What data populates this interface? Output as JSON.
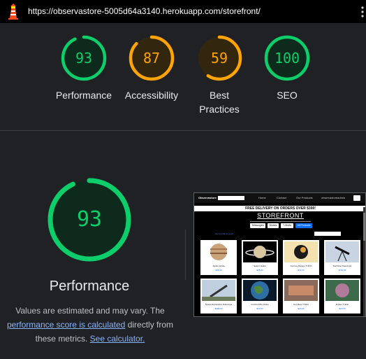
{
  "topbar": {
    "url": "https://observastore-5005d64a3140.herokuapp.com/storefront/",
    "logo_icon": "lighthouse-icon",
    "menu_icon": "kebab-menu-icon"
  },
  "scores": [
    {
      "name": "Performance",
      "value": "93",
      "score": 93,
      "color": "#0cce6b",
      "bg": "#0e2a1c"
    },
    {
      "name": "Accessibility",
      "value": "87",
      "score": 87,
      "color": "#ffa400",
      "bg": "#33260f"
    },
    {
      "name": "Best\nPractices",
      "value": "59",
      "score": 59,
      "color": "#ffa400",
      "bg": "#33260f"
    },
    {
      "name": "SEO",
      "value": "100",
      "score": 100,
      "color": "#0cce6b",
      "bg": "#0e2a1c"
    }
  ],
  "performance": {
    "value": "93",
    "score": 93,
    "title": "Performance",
    "note_prefix": "Values are estimated and may vary. The ",
    "note_link": "performance score is calculated",
    "note_middle": " directly from these metrics. ",
    "note_calc": "See calculator."
  },
  "screenshot": {
    "brand": "Observastore",
    "nav": [
      "Home",
      "Contact",
      "Our Products",
      "observastoreadmin"
    ],
    "banner": "FREE DELIVERY ON ORDERS OVER $300!",
    "heading": "STOREFRONT",
    "categories": [
      "Telescopes",
      "Globes",
      "T-Shirts",
      "All Products"
    ],
    "sort_label": "Sort by Name (A-Z) ...",
    "products": [
      {
        "name": "Jupiter Globe",
        "price": "$25.00"
      },
      {
        "name": "Saturn Globe",
        "price": "$25.00"
      },
      {
        "name": "Journey Ranger T-Shirt",
        "price": "$20.00"
      },
      {
        "name": "Northstar Telescope",
        "price": "$750.00"
      },
      {
        "name": "Space Exploration Telescope",
        "price": "$399.00"
      },
      {
        "name": "Colorful Mini Globe",
        "price": "$10.00"
      },
      {
        "name": "Get Mars T-Shirt",
        "price": "$20.00"
      },
      {
        "name": "Jupiter T-Shirt",
        "price": "$20.00"
      }
    ]
  }
}
